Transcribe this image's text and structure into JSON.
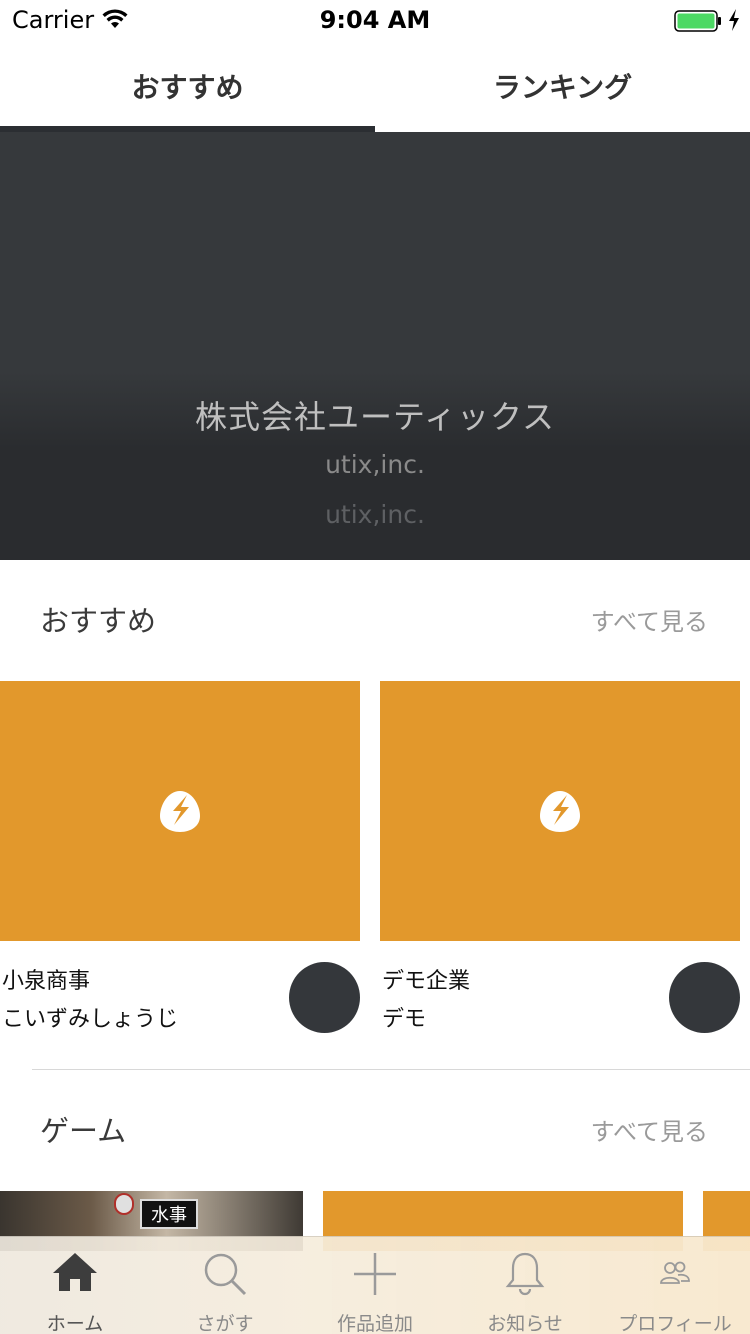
{
  "status_bar": {
    "carrier": "Carrier",
    "time": "9:04 AM"
  },
  "top_tabs": [
    {
      "label": "おすすめ",
      "selected": true
    },
    {
      "label": "ランキング",
      "selected": false
    }
  ],
  "hero": {
    "title": "株式会社ユーティックス",
    "subtitle": "utix,inc.",
    "subtitle2": "utix,inc."
  },
  "sections": [
    {
      "title": "おすすめ",
      "more_label": "すべて見る",
      "cards": [
        {
          "name": "小泉商事",
          "kana": "こいずみしょうじ",
          "thumb_color": "#e2982c"
        },
        {
          "name": "デモ企業",
          "kana": "デモ",
          "thumb_color": "#e2982c"
        }
      ]
    },
    {
      "title": "ゲーム",
      "more_label": "すべて見る",
      "photo_sign": "水事"
    }
  ],
  "tab_bar": [
    {
      "label": "ホーム",
      "icon": "home-icon",
      "active": true
    },
    {
      "label": "さがす",
      "icon": "search-icon",
      "active": false
    },
    {
      "label": "作品追加",
      "icon": "plus-icon",
      "active": false
    },
    {
      "label": "お知らせ",
      "icon": "bell-icon",
      "active": false
    },
    {
      "label": "プロフィール",
      "icon": "people-icon",
      "active": false
    }
  ],
  "colors": {
    "accent_orange": "#e2982c",
    "dark": "#36393c",
    "battery_green": "#4cd964"
  }
}
